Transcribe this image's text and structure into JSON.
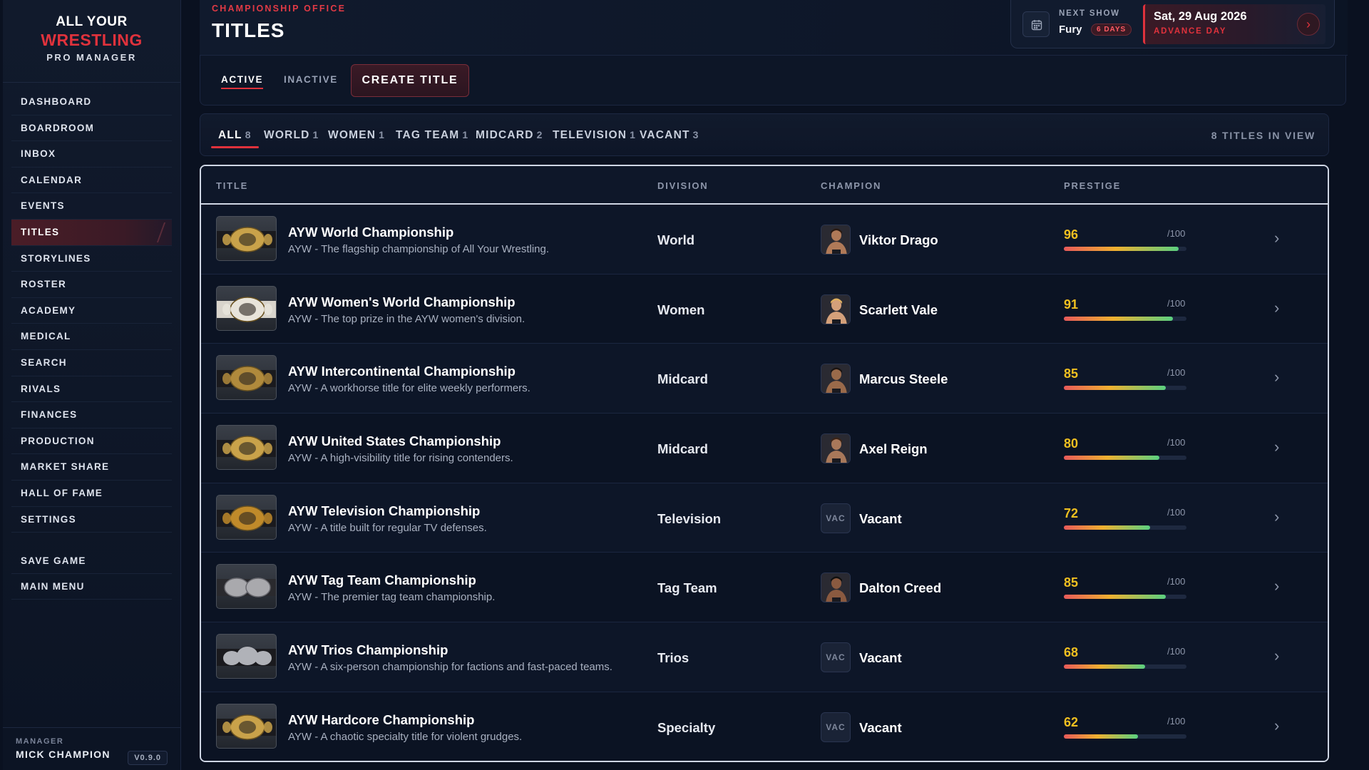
{
  "app": {
    "logo_line1": "ALL YOUR",
    "logo_line2": "WRESTLING",
    "logo_line3": "PRO MANAGER"
  },
  "sidebar": {
    "items": [
      {
        "label": "DASHBOARD",
        "active": false
      },
      {
        "label": "BOARDROOM",
        "active": false
      },
      {
        "label": "INBOX",
        "active": false
      },
      {
        "label": "CALENDAR",
        "active": false
      },
      {
        "label": "EVENTS",
        "active": false
      },
      {
        "label": "TITLES",
        "active": true
      },
      {
        "label": "STORYLINES",
        "active": false
      },
      {
        "label": "ROSTER",
        "active": false
      },
      {
        "label": "ACADEMY",
        "active": false
      },
      {
        "label": "MEDICAL",
        "active": false
      },
      {
        "label": "SEARCH",
        "active": false
      },
      {
        "label": "RIVALS",
        "active": false
      },
      {
        "label": "FINANCES",
        "active": false
      },
      {
        "label": "PRODUCTION",
        "active": false
      },
      {
        "label": "MARKET SHARE",
        "active": false
      },
      {
        "label": "HALL OF FAME",
        "active": false
      },
      {
        "label": "SETTINGS",
        "active": false
      }
    ],
    "bottom_items": [
      {
        "label": "SAVE GAME"
      },
      {
        "label": "MAIN MENU"
      }
    ],
    "manager_label": "MANAGER",
    "manager_name": "MICK CHAMPION",
    "version": "V0.9.0"
  },
  "header": {
    "kicker": "CHAMPIONSHIP OFFICE",
    "title": "TITLES",
    "next_show_label": "NEXT SHOW",
    "next_show_name": "Fury",
    "next_show_badge": "6 DAYS",
    "date": "Sat, 29 Aug 2026",
    "advance_label": "ADVANCE DAY",
    "accent_color": "#e0323c"
  },
  "tabs": {
    "active_label": "ACTIVE",
    "inactive_label": "INACTIVE",
    "create_label": "CREATE TITLE"
  },
  "filters": {
    "chips": [
      {
        "label": "ALL",
        "count": "8",
        "active": true
      },
      {
        "label": "WORLD",
        "count": "1",
        "active": false
      },
      {
        "label": "WOMEN",
        "count": "1",
        "active": false
      },
      {
        "label": "TAG TEAM",
        "count": "1",
        "active": false
      },
      {
        "label": "MIDCARD",
        "count": "2",
        "active": false
      },
      {
        "label": "TELEVISION",
        "count": "1",
        "active": false
      },
      {
        "label": "VACANT",
        "count": "3",
        "active": false
      }
    ],
    "in_view": "8 TITLES IN VIEW"
  },
  "table": {
    "headers": {
      "title": "TITLE",
      "division": "DIVISION",
      "champion": "CHAMPION",
      "prestige": "PRESTIGE"
    },
    "prestige_max": "/100",
    "rows": [
      {
        "name": "AYW World Championship",
        "desc": "AYW - The flagship championship of All Your Wrestling.",
        "division": "World",
        "champion": "Viktor Drago",
        "vacant": false,
        "prestige": 96,
        "belt": "gold"
      },
      {
        "name": "AYW Women's World Championship",
        "desc": "AYW - The top prize in the AYW women's division.",
        "division": "Women",
        "champion": "Scarlett Vale",
        "vacant": false,
        "prestige": 91,
        "belt": "white"
      },
      {
        "name": "AYW Intercontinental Championship",
        "desc": "AYW - A workhorse title for elite weekly performers.",
        "division": "Midcard",
        "champion": "Marcus Steele",
        "vacant": false,
        "prestige": 85,
        "belt": "black-gold"
      },
      {
        "name": "AYW United States Championship",
        "desc": "AYW - A high-visibility title for rising contenders.",
        "division": "Midcard",
        "champion": "Axel Reign",
        "vacant": false,
        "prestige": 80,
        "belt": "stars"
      },
      {
        "name": "AYW Television Championship",
        "desc": "AYW - A title built for regular TV defenses.",
        "division": "Television",
        "champion": "Vacant",
        "vacant": true,
        "prestige": 72,
        "belt": "tv"
      },
      {
        "name": "AYW Tag Team Championship",
        "desc": "AYW - The premier tag team championship.",
        "division": "Tag Team",
        "champion": "Dalton Creed",
        "vacant": false,
        "prestige": 85,
        "belt": "double"
      },
      {
        "name": "AYW Trios Championship",
        "desc": "AYW - A six-person championship for factions and fast-paced teams.",
        "division": "Trios",
        "champion": "Vacant",
        "vacant": true,
        "prestige": 68,
        "belt": "triple"
      },
      {
        "name": "AYW Hardcore Championship",
        "desc": "AYW - A chaotic specialty title for violent grudges.",
        "division": "Specialty",
        "champion": "Vacant",
        "vacant": true,
        "prestige": 62,
        "belt": "hardcore"
      }
    ],
    "vacant_badge": "VAC"
  }
}
